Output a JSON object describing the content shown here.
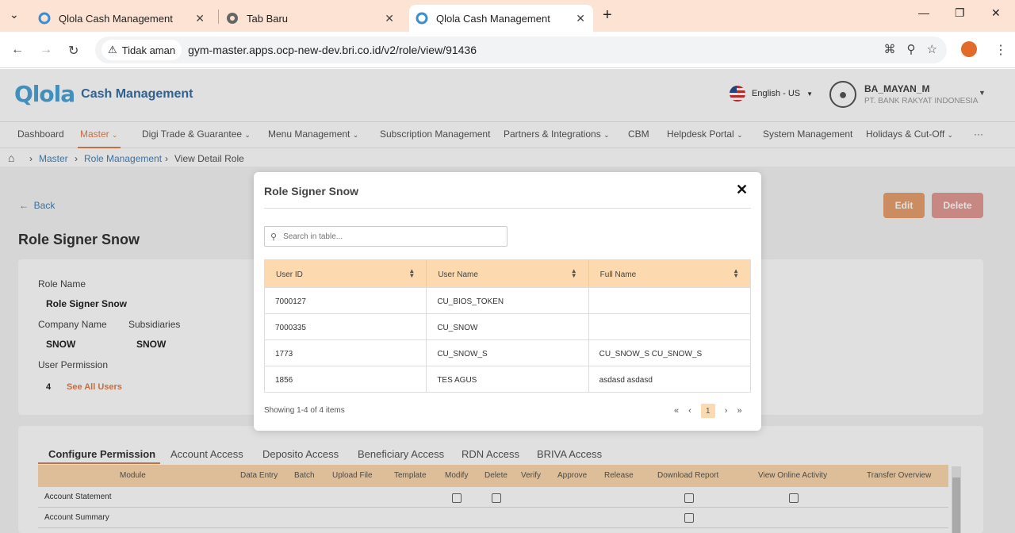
{
  "browser": {
    "tabs": [
      {
        "title": "Qlola Cash Management"
      },
      {
        "title": "Tab Baru"
      },
      {
        "title": "Qlola Cash Management"
      }
    ],
    "security_label": "Tidak aman",
    "url": "gym-master.apps.ocp-new-dev.bri.co.id/v2/role/view/91436"
  },
  "app": {
    "logo_text": "Qlola",
    "brand": "Cash Management",
    "language": "English - US",
    "user_name": "BA_MAYAN_M",
    "company": "PT. BANK RAKYAT INDONESIA"
  },
  "nav": {
    "items": [
      "Dashboard",
      "Master",
      "Digi Trade & Guarantee",
      "Menu Management",
      "Subscription Management",
      "Partners & Integrations",
      "CBM",
      "Helpdesk Portal",
      "System Management",
      "Holidays & Cut-Off",
      "···"
    ]
  },
  "breadcrumb": {
    "items": [
      "Master",
      "Role Management",
      "View Detail Role"
    ]
  },
  "page": {
    "back": "Back",
    "edit": "Edit",
    "delete": "Delete",
    "title": "Role Signer Snow",
    "role_name_label": "Role Name",
    "role_name": "Role Signer Snow",
    "company_label": "Company Name",
    "company": "SNOW",
    "subsidiaries_label": "Subsidiaries",
    "subsidiaries": "SNOW",
    "user_permission_label": "User Permission",
    "user_permission_count": "4",
    "see_all": "See All Users",
    "tabs": [
      "Configure Permission",
      "Account Access",
      "Deposito Access",
      "Beneficiary Access",
      "RDN Access",
      "BRIVA Access"
    ],
    "perm_headers": [
      "Module",
      "Data Entry",
      "Batch",
      "Upload File",
      "Template",
      "Modify",
      "Delete",
      "Verify",
      "Approve",
      "Release",
      "Download Report",
      "View Online Activity",
      "Transfer Overview"
    ],
    "perm_rows": [
      "Account Statement",
      "Account Summary"
    ]
  },
  "modal": {
    "title": "Role Signer Snow",
    "search_placeholder": "Search in table...",
    "columns": [
      "User ID",
      "User Name",
      "Full Name"
    ],
    "rows": [
      [
        "7000127",
        "CU_BIOS_TOKEN",
        ""
      ],
      [
        "7000335",
        "CU_SNOW",
        ""
      ],
      [
        "1773",
        "CU_SNOW_S",
        "CU_SNOW_S CU_SNOW_S"
      ],
      [
        "1856",
        "TES AGUS",
        "asdasd asdasd"
      ]
    ],
    "footer": "Showing 1-4 of 4 items",
    "page": "1"
  },
  "colors": {
    "accent": "#e0804f",
    "header_bg": "#fcd9ae",
    "link": "#4a7fb0"
  }
}
